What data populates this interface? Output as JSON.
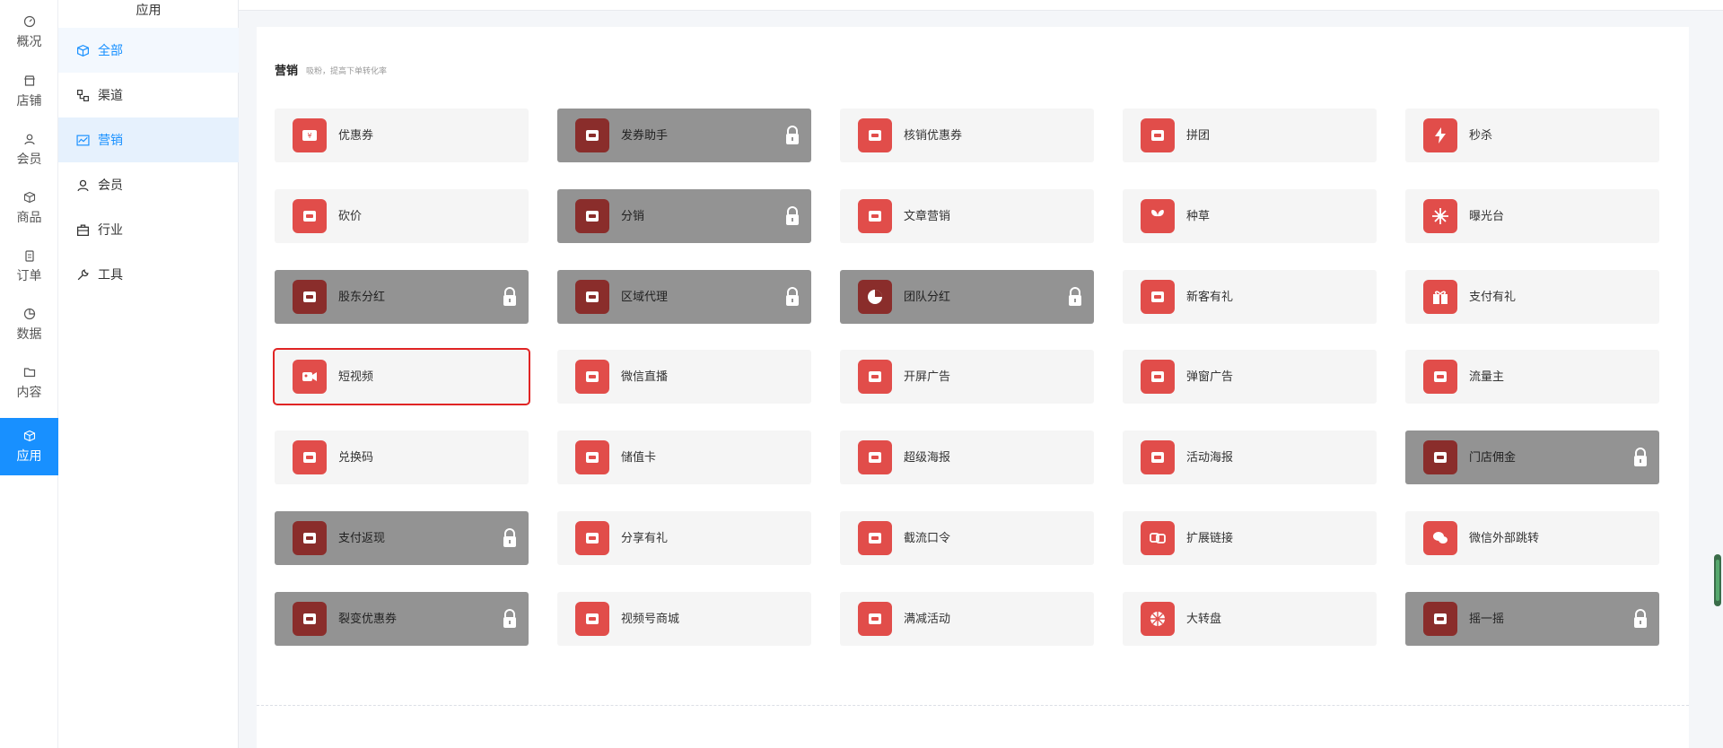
{
  "rail": {
    "items": [
      {
        "label": "概况",
        "icon": "dashboard-icon"
      },
      {
        "label": "店铺",
        "icon": "store-icon"
      },
      {
        "label": "会员",
        "icon": "user-icon"
      },
      {
        "label": "商品",
        "icon": "box-icon"
      },
      {
        "label": "订单",
        "icon": "clipboard-icon"
      },
      {
        "label": "数据",
        "icon": "pie-icon"
      },
      {
        "label": "内容",
        "icon": "folder-icon"
      },
      {
        "label": "应用",
        "icon": "cube-icon",
        "active": true
      }
    ]
  },
  "submenu": {
    "title": "应用",
    "items": [
      {
        "label": "全部",
        "icon": "cube-icon"
      },
      {
        "label": "渠道",
        "icon": "channel-icon"
      },
      {
        "label": "营销",
        "icon": "chart-line-icon"
      },
      {
        "label": "会员",
        "icon": "user-icon"
      },
      {
        "label": "行业",
        "icon": "briefcase-icon"
      },
      {
        "label": "工具",
        "icon": "wrench-icon"
      }
    ]
  },
  "section": {
    "title": "营销",
    "subtitle": "吸粉，提高下单转化率"
  },
  "apps": [
    {
      "label": "优惠券",
      "icon": "coupon-icon",
      "locked": false
    },
    {
      "label": "发券助手",
      "icon": "coupon-helper-icon",
      "locked": true
    },
    {
      "label": "核销优惠券",
      "icon": "verify-coupon-icon",
      "locked": false
    },
    {
      "label": "拼团",
      "icon": "group-buy-icon",
      "locked": false
    },
    {
      "label": "秒杀",
      "icon": "lightning-icon",
      "locked": false
    },
    {
      "label": "砍价",
      "icon": "price-tag-icon",
      "locked": false
    },
    {
      "label": "分销",
      "icon": "money-bag-icon",
      "locked": true
    },
    {
      "label": "文章营销",
      "icon": "article-icon",
      "locked": false
    },
    {
      "label": "种草",
      "icon": "sprout-icon",
      "locked": false
    },
    {
      "label": "曝光台",
      "icon": "sparkle-icon",
      "locked": false
    },
    {
      "label": "股东分红",
      "icon": "hand-coins-icon",
      "locked": true
    },
    {
      "label": "区域代理",
      "icon": "coin-stack-icon",
      "locked": true
    },
    {
      "label": "团队分红",
      "icon": "pie-chart-icon",
      "locked": true
    },
    {
      "label": "新客有礼",
      "icon": "new-customer-icon",
      "locked": false
    },
    {
      "label": "支付有礼",
      "icon": "gift-icon",
      "locked": false
    },
    {
      "label": "短视频",
      "icon": "video-camera-icon",
      "locked": false,
      "selected": true
    },
    {
      "label": "微信直播",
      "icon": "live-camera-icon",
      "locked": false
    },
    {
      "label": "开屏广告",
      "icon": "ad-screen-icon",
      "locked": false
    },
    {
      "label": "弹窗广告",
      "icon": "popup-ad-icon",
      "locked": false
    },
    {
      "label": "流量主",
      "icon": "traffic-drop-icon",
      "locked": false
    },
    {
      "label": "兑换码",
      "icon": "redeem-code-icon",
      "locked": false
    },
    {
      "label": "储值卡",
      "icon": "stored-card-icon",
      "locked": false
    },
    {
      "label": "超级海报",
      "icon": "star-badge-icon",
      "locked": false
    },
    {
      "label": "活动海报",
      "icon": "dial-icon",
      "locked": false
    },
    {
      "label": "门店佣金",
      "icon": "store-commission-icon",
      "locked": true
    },
    {
      "label": "支付返现",
      "icon": "cashback-icon",
      "locked": true
    },
    {
      "label": "分享有礼",
      "icon": "share-gift-icon",
      "locked": false
    },
    {
      "label": "截流口令",
      "icon": "command-icon",
      "locked": false
    },
    {
      "label": "扩展链接",
      "icon": "link-icon",
      "locked": false
    },
    {
      "label": "微信外部跳转",
      "icon": "wechat-icon",
      "locked": false
    },
    {
      "label": "裂变优惠券",
      "icon": "fission-coupon-icon",
      "locked": true
    },
    {
      "label": "视频号商城",
      "icon": "video-shop-icon",
      "locked": false
    },
    {
      "label": "满减活动",
      "icon": "discount-icon",
      "locked": false
    },
    {
      "label": "大转盘",
      "icon": "wheel-icon",
      "locked": false
    },
    {
      "label": "摇一摇",
      "icon": "shake-icon",
      "locked": true
    }
  ],
  "colors": {
    "accent": "#1890ff",
    "app_icon": "#e14d4a",
    "locked_card": "#939393",
    "selected_outline": "#e02424"
  }
}
